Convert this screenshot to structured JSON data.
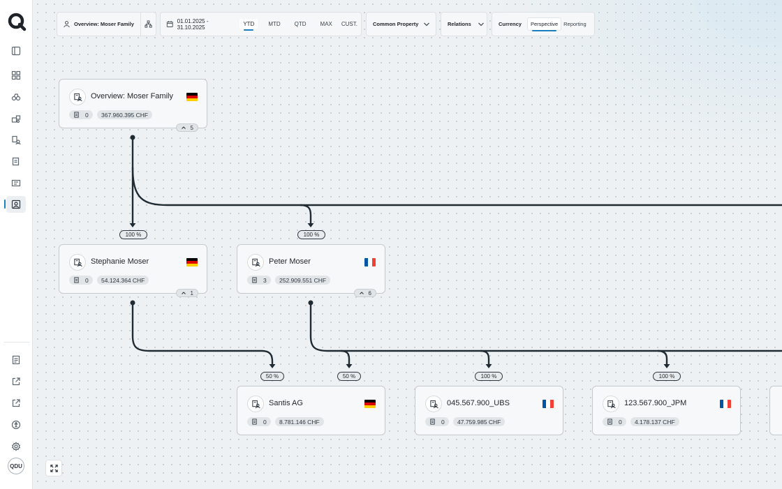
{
  "toolbar": {
    "entity_label": "Overview: Moser Family",
    "date_range": "01.01.2025 - 31.10.2025",
    "periods": [
      "YTD",
      "MTD",
      "QTD",
      "MAX",
      "CUST."
    ],
    "selected_period": "YTD",
    "common_property_label": "Common Property",
    "relations_label": "Relations",
    "currency_label": "Currency",
    "currency_options": [
      "Perspective",
      "Reporting"
    ],
    "selected_currency_option": "Perspective"
  },
  "sidebar": {
    "avatar_initials": "QDU"
  },
  "nodes": {
    "root": {
      "title": "Overview: Moser Family",
      "docs": "0",
      "amount": "367.960.395 CHF",
      "children": "5",
      "flag": "de"
    },
    "stephanie": {
      "title": "Stephanie Moser",
      "docs": "0",
      "amount": "54.124.364 CHF",
      "children": "1",
      "flag": "de"
    },
    "peter": {
      "title": "Peter Moser",
      "docs": "3",
      "amount": "252.909.551 CHF",
      "children": "6",
      "flag": "fr"
    },
    "santis": {
      "title": "Santis AG",
      "docs": "0",
      "amount": "8.781.146 CHF",
      "flag": "de"
    },
    "ubs": {
      "title": "045.567.900_UBS",
      "docs": "0",
      "amount": "47.759.985 CHF",
      "flag": "fr"
    },
    "jpm": {
      "title": "123.567.900_JPM",
      "docs": "0",
      "amount": "4.178.137 CHF",
      "flag": "fr"
    }
  },
  "edges": {
    "root_to_stephanie": "100 %",
    "root_to_peter": "100 %",
    "stephanie_to_santis": "50 %",
    "peter_to_santis": "50 %",
    "peter_to_ubs": "100 %",
    "peter_to_jpm": "100 %"
  },
  "colors": {
    "accent": "#1a7fbf",
    "edge": "#1f2a33",
    "flag_de": [
      "#000000",
      "#dd0000",
      "#ffce00"
    ],
    "flag_fr": [
      "#0055a4",
      "#ffffff",
      "#ef4135"
    ]
  }
}
